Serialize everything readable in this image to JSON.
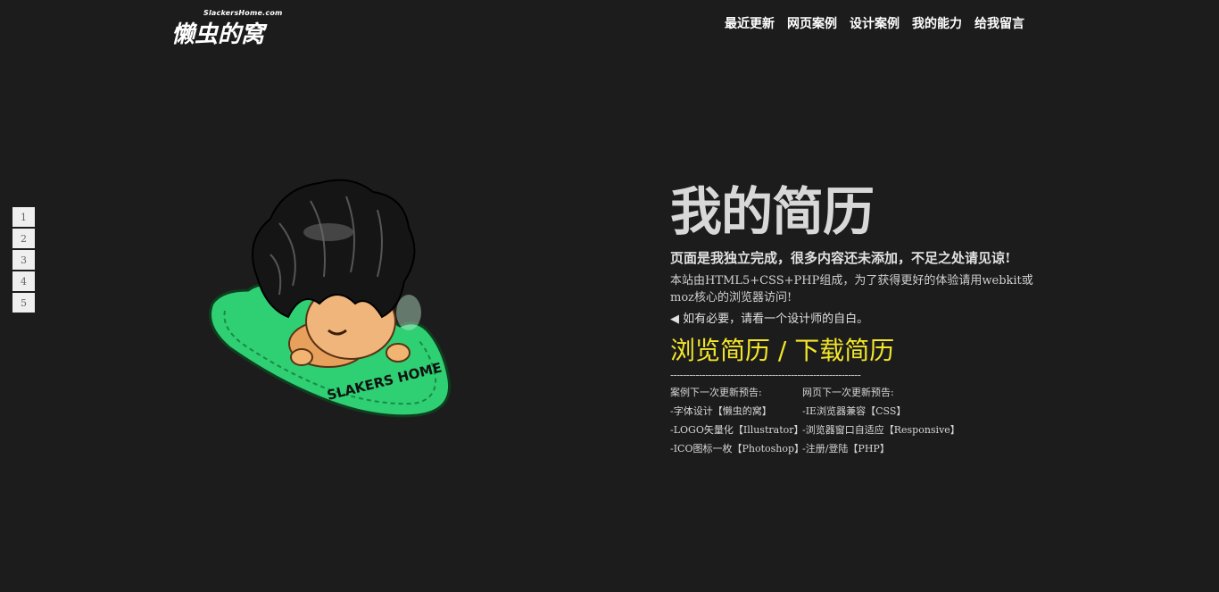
{
  "header": {
    "logo_domain": "SlackersHome.com",
    "logo_name": "懒虫的窝",
    "nav": [
      "最近更新",
      "网页案例",
      "设计案例",
      "我的能力",
      "给我留言"
    ]
  },
  "pager": [
    "1",
    "2",
    "3",
    "4",
    "5"
  ],
  "mascot": {
    "badge_text": "SLAKERS HOME"
  },
  "resume": {
    "title": "我的简历",
    "subtitle": "页面是我独立完成，很多内容还未添加，不足之处请见谅!",
    "desc": "本站由HTML5+CSS+PHP组成，为了获得更好的体验请用webkit或moz核心的浏览器访问!",
    "hint": "◀ 如有必要，请看一个设计师的自白。",
    "link_browse": "浏览简历",
    "link_sep": " / ",
    "link_download": "下载简历",
    "dashes": "------------------------------------------------------------",
    "left_col": {
      "heading": "案例下一次更新预告:",
      "items": [
        "-字体设计【懒虫的窝】",
        "-LOGO矢量化【Illustrator】",
        "-ICO图标一枚【Photoshop】"
      ]
    },
    "right_col": {
      "heading": "网页下一次更新预告:",
      "items": [
        "-IE浏览器兼容【CSS】",
        "-浏览器窗口自适应【Responsive】",
        "-注册/登陆【PHP】"
      ]
    }
  },
  "colors": {
    "background": "#1c1c1c",
    "link_accent": "#f3e62a",
    "cushion": "#2ecc71"
  }
}
